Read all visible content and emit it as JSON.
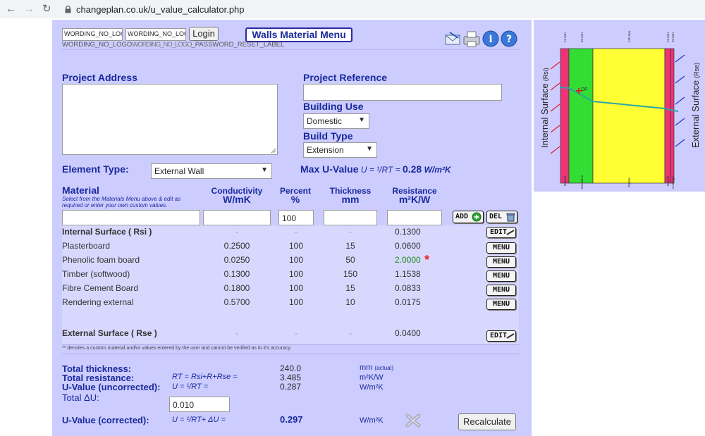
{
  "browser": {
    "url": "changeplan.co.uk/u_value_calculator.php"
  },
  "header": {
    "wording_input_1": "WORDING_NO_LOGO",
    "wording_input_2": "WORDING_NO_LOGO",
    "login_label": "Login",
    "menu_title": "Walls Material Menu",
    "under_text": "WORDING_NO_LOGO",
    "overlap_text": "WORDING_NO_LOGO",
    "reset_text": "_PASSWORD_RESET_LABEL"
  },
  "project": {
    "address_label": "Project Address",
    "reference_label": "Project Reference",
    "building_use_label": "Building Use",
    "building_use_value": "Domestic",
    "build_type_label": "Build Type",
    "build_type_value": "Extension"
  },
  "element": {
    "label": "Element Type:",
    "value": "External Wall",
    "max_u_label": "Max U-Value",
    "max_u_formula": "U = ¹/RT =",
    "max_u_value": "0.28",
    "max_u_unit": "W/m²K"
  },
  "table": {
    "material_header": "Material",
    "material_hint": "Select from the Materials Menu above & edit as required or enter your own custom values.",
    "conductivity_header": "Conductivity",
    "conductivity_unit": "W/mK",
    "percent_header": "Percent",
    "percent_unit": "%",
    "thickness_header": "Thickness",
    "thickness_unit": "mm",
    "resistance_header": "Resistance",
    "resistance_unit": "m²K/W",
    "percent_input": "100",
    "add_label": "ADD",
    "del_label": "DEL",
    "rows": [
      {
        "name": "Internal Surface ( Rsi )",
        "conductivity": "-",
        "percent": "-",
        "thickness": "-",
        "resistance": "0.1300",
        "button": "EDIT",
        "bold": true
      },
      {
        "name": "Plasterboard",
        "conductivity": "0.2500",
        "percent": "100",
        "thickness": "15",
        "resistance": "0.0600",
        "button": "MENU"
      },
      {
        "name": "Phenolic foam board",
        "conductivity": "0.0250",
        "percent": "100",
        "thickness": "50",
        "resistance": "2.0000",
        "button": "MENU",
        "custom": true
      },
      {
        "name": "Timber (softwood)",
        "conductivity": "0.1300",
        "percent": "100",
        "thickness": "150",
        "resistance": "1.1538",
        "button": "MENU"
      },
      {
        "name": "Fibre Cement Board",
        "conductivity": "0.1800",
        "percent": "100",
        "thickness": "15",
        "resistance": "0.0833",
        "button": "MENU"
      },
      {
        "name": "Rendering external",
        "conductivity": "0.5700",
        "percent": "100",
        "thickness": "10",
        "resistance": "0.0175",
        "button": "MENU"
      }
    ],
    "external": {
      "name": "External Surface ( Rse )",
      "conductivity": "-",
      "percent": "-",
      "thickness": "-",
      "resistance": "0.0400",
      "button": "EDIT"
    },
    "custom_marker": "*",
    "footnote": "** denotes a custom material and/or values entered by the user and cannot be verified as to it’s accuracy."
  },
  "totals": {
    "thickness_label": "Total thickness:",
    "thickness_value": "240.0",
    "thickness_unit": "mm",
    "thickness_note": "(actual)",
    "resistance_label": "Total resistance:",
    "resistance_formula": "RT = Rsi+R+Rse =",
    "resistance_value": "3.485",
    "resistance_unit": "m²K/W",
    "u_unc_label": "U-Value (uncorrected):",
    "u_unc_formula": "U = ¹/RT =",
    "u_unc_value": "0.287",
    "u_unc_unit": "W/m²K",
    "delta_label": "Total ΔU:",
    "delta_value": "0.010",
    "u_cor_label": "U-Value (corrected):",
    "u_cor_formula": "U = ¹/RT+ ΔU =",
    "u_cor_value": "0.297",
    "u_cor_unit": "W/m²K",
    "recalc_label": "Recalculate"
  },
  "diagram": {
    "internal_label": "Internal Surface",
    "internal_sub": "(Rsi)",
    "external_label": "External Surface",
    "external_sub": "(Rse)",
    "dp_label": "DP",
    "top_labels": [
      "15 mm",
      "50 mm",
      "150 mm",
      "15 mm",
      "10 mm"
    ],
    "bottom_labels": [
      "Boards",
      "Insulation",
      "Timber",
      "Boards",
      "Coatings"
    ]
  },
  "colors": {
    "panel": "#ccccff",
    "heading": "#1a2a9c",
    "insulation": "#33dd33",
    "timber": "#ffff33",
    "board": "#ee3377",
    "custom_star": "#ee2222"
  }
}
